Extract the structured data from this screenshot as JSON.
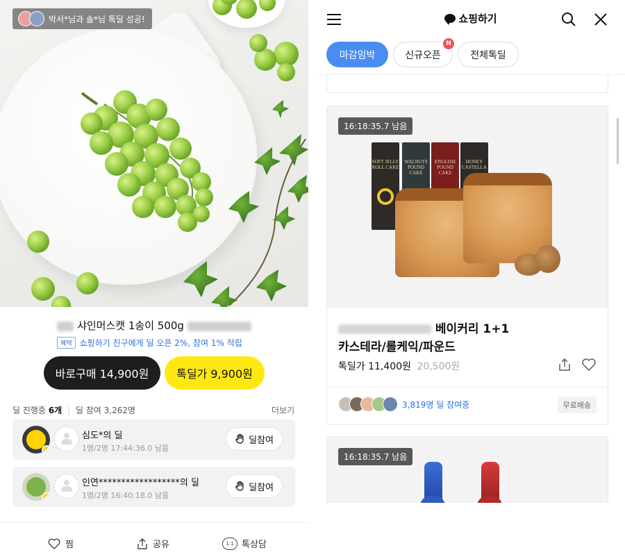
{
  "left": {
    "toast": {
      "text": "박서*님과 솔*님 톡딜 성공!"
    },
    "product": {
      "title": "샤인머스캣 1송이 500g",
      "benefit_tag": "혜택",
      "benefit_text": "쇼핑하기 친구에게 딜 오픈 2%, 참여 1% 적립"
    },
    "buttons": {
      "buy_now": "바로구매 14,900원",
      "talkdeal": "톡딜가 9,900원"
    },
    "stats": {
      "ongoing_label": "딜 진행중",
      "ongoing_count": "6개",
      "separator": "|",
      "participants": "딜 참여 3,262명",
      "more": "더보기"
    },
    "deals": [
      {
        "name": "심도*의 딜",
        "meta": "1명/2명  17:44:36.0 남음",
        "join_label": "딜참여"
      },
      {
        "name": "인연******************의 딜",
        "meta": "1명/2명  16:40:18.0 남음",
        "join_label": "딜참여"
      }
    ],
    "bottom_bar": {
      "wish": "찜",
      "share": "공유",
      "chat": "톡상담",
      "chat_icon_text": "1:1"
    }
  },
  "right": {
    "header": {
      "title": "쇼핑하기"
    },
    "tabs": [
      {
        "label": "마감임박",
        "active": true
      },
      {
        "label": "신규오픈",
        "badge": "N"
      },
      {
        "label": "전체톡딜"
      }
    ],
    "cards": [
      {
        "timer": "16:18:35.7 남음",
        "box_labels": [
          "SOFT JELLY ROLL CAKE",
          "WALNUTS POUND CAKE",
          "ENGLISH POUND CAKE",
          "HONEY CASTELLA"
        ],
        "name_line1": "베이커리 1+1",
        "name_line2": "카스테라/롤케익/파운드",
        "price_label": "톡딜가",
        "price": "11,400원",
        "original_price": "20,500원",
        "participants": "3,819명 딜 참여중",
        "shipping": "무료배송"
      },
      {
        "timer": "16:18:35.7 남음"
      }
    ]
  },
  "colors": {
    "accent_blue": "#4a8df0",
    "kakao_yellow": "#ffe812",
    "badge_red": "#f0515a",
    "link_blue": "#2f6fe0"
  },
  "icons": [
    "grapes-photo",
    "cake-photo",
    "heart-icon",
    "share-icon",
    "chat-icon",
    "menu-icon",
    "search-icon",
    "close-icon",
    "hand-icon",
    "person-placeholder-icon"
  ]
}
